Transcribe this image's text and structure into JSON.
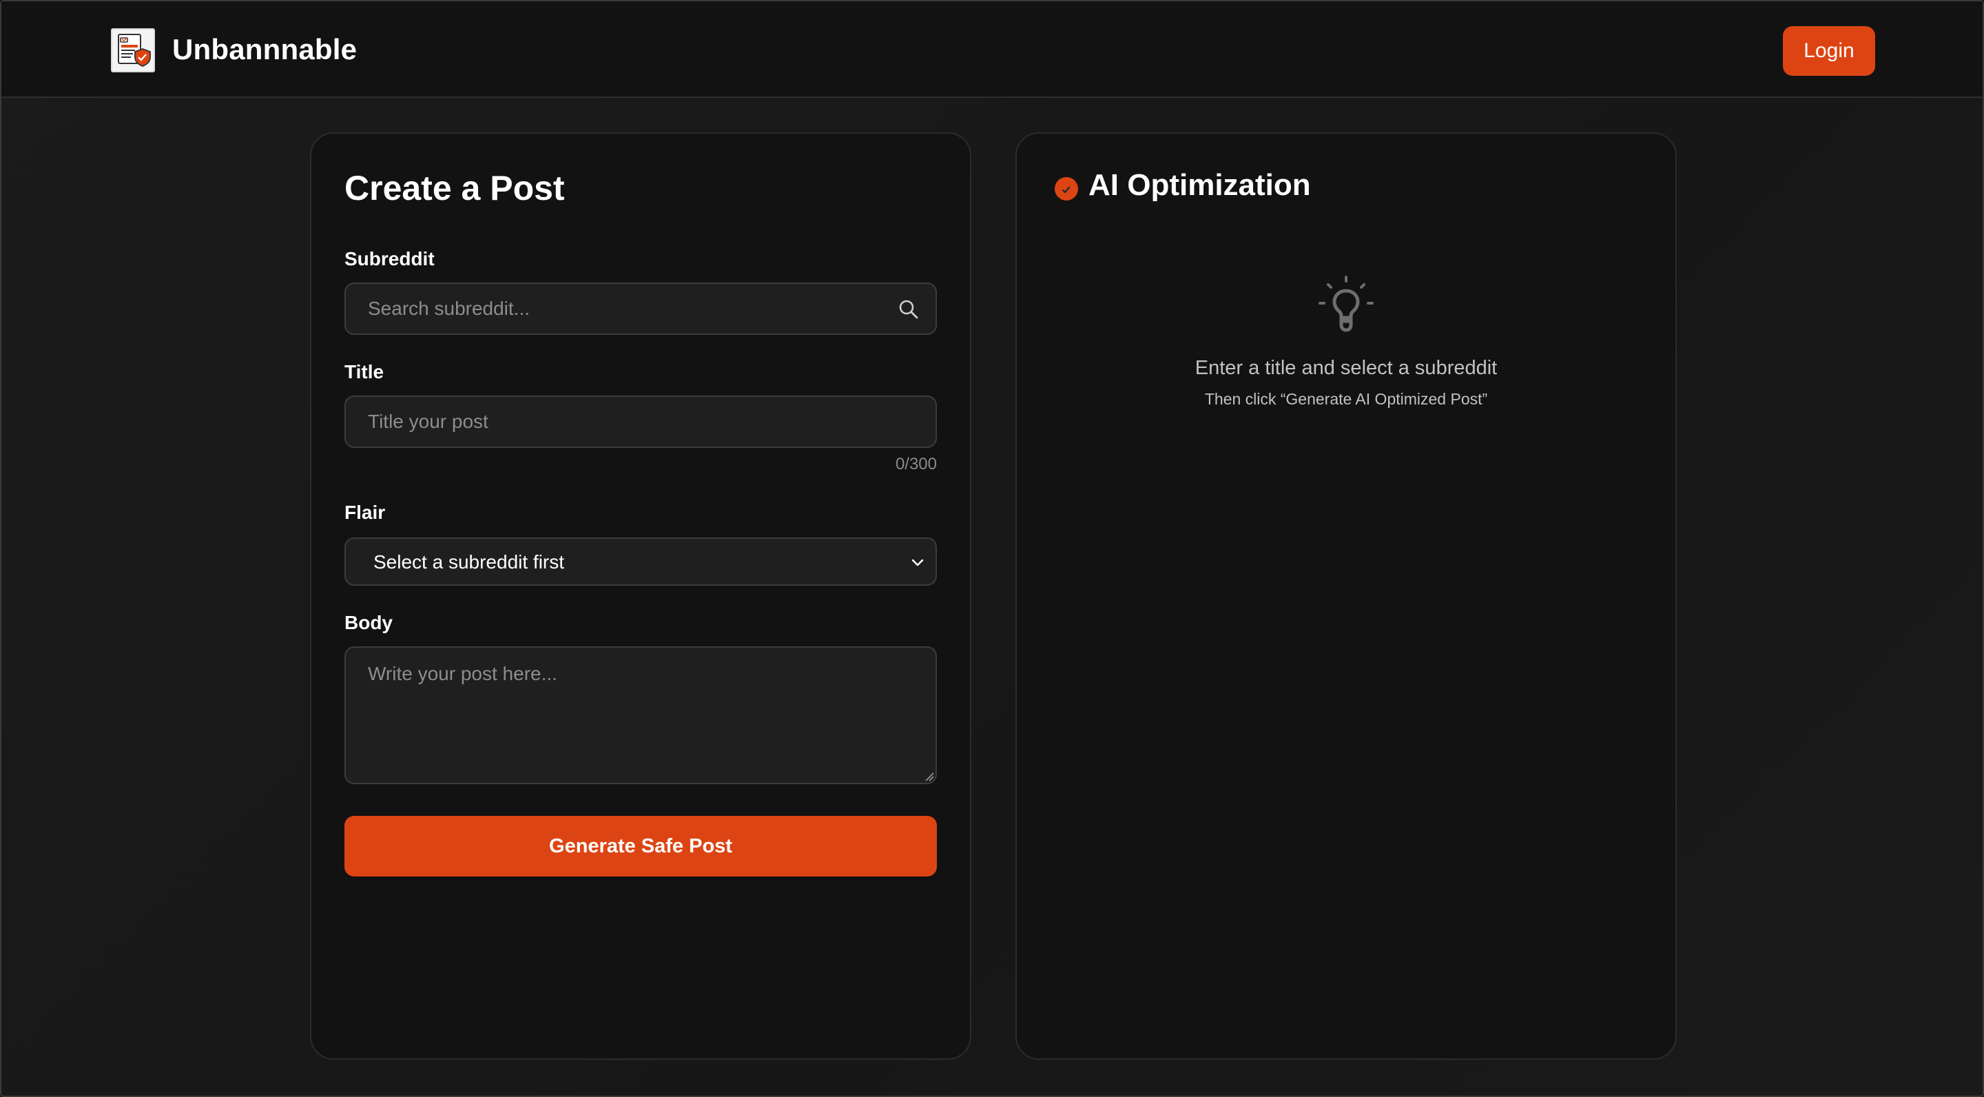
{
  "header": {
    "brand": "Unbannnable",
    "login_label": "Login"
  },
  "create_post": {
    "title": "Create a Post",
    "subreddit": {
      "label": "Subreddit",
      "placeholder": "Search subreddit...",
      "value": ""
    },
    "post_title": {
      "label": "Title",
      "placeholder": "Title your post",
      "value": "",
      "counter": "0/300"
    },
    "flair": {
      "label": "Flair",
      "selected": "Select a subreddit first"
    },
    "body": {
      "label": "Body",
      "placeholder": "Write your post here...",
      "value": ""
    },
    "generate_label": "Generate Safe Post"
  },
  "ai_panel": {
    "title": "AI Optimization",
    "empty_main": "Enter a title and select a subreddit",
    "empty_sub": "Then click “Generate AI Optimized Post”"
  },
  "colors": {
    "accent": "#dc4513",
    "background": "#191919",
    "panel": "#121212"
  },
  "icons": {
    "logo": "document-shield-icon",
    "search": "search-icon",
    "chevron": "chevron-down-icon",
    "ai": "check-badge-icon",
    "empty_state": "lightbulb-icon"
  }
}
